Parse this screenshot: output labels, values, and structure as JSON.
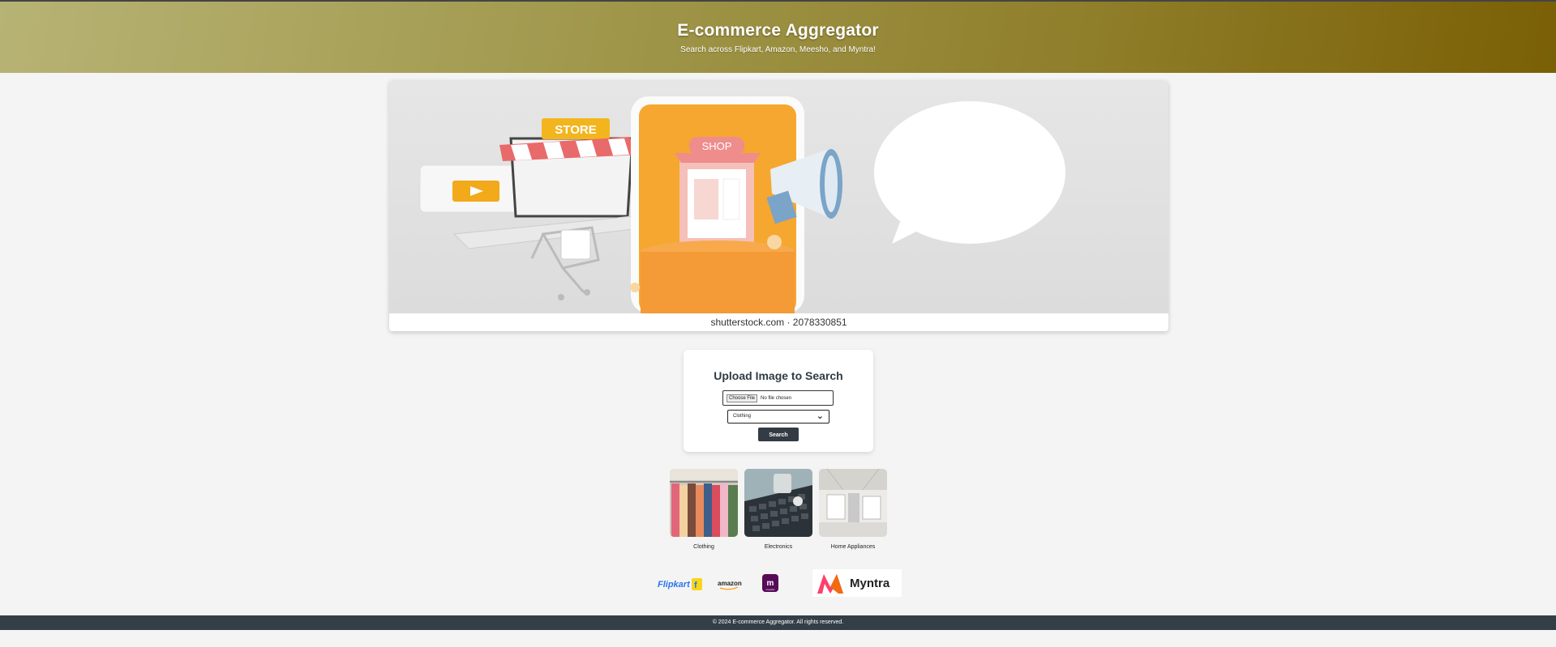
{
  "header": {
    "title": "E-commerce Aggregator",
    "subtitle": "Search across Flipkart, Amazon, Meesho, and Myntra!"
  },
  "banner": {
    "store_sign": "STORE",
    "shop_sign": "SHOP",
    "caption": "shutterstock.com · 2078330851"
  },
  "upload": {
    "heading": "Upload Image to Search",
    "choose_file_label": "Choose File",
    "file_status": "No file chosen",
    "category_selected": "Clothing",
    "search_label": "Search"
  },
  "categories": [
    {
      "label": "Clothing",
      "icon": "clothing-rack-photo"
    },
    {
      "label": "Electronics",
      "icon": "keyboard-photo"
    },
    {
      "label": "Home Appliances",
      "icon": "appliance-photo"
    }
  ],
  "brands": {
    "flipkart": "Flipkart",
    "amazon": "amazon",
    "meesho_letter": "m",
    "meesho_small": "meesho",
    "myntra": "Myntra"
  },
  "footer": {
    "text": "© 2024 E-commerce Aggregator. All rights reserved."
  },
  "colors": {
    "header_gradient_start": "#b7b374",
    "header_gradient_end": "#7a5f05",
    "button_dark": "#333c45",
    "footer_bg": "#333e47",
    "page_bg": "#f4f4f4"
  }
}
